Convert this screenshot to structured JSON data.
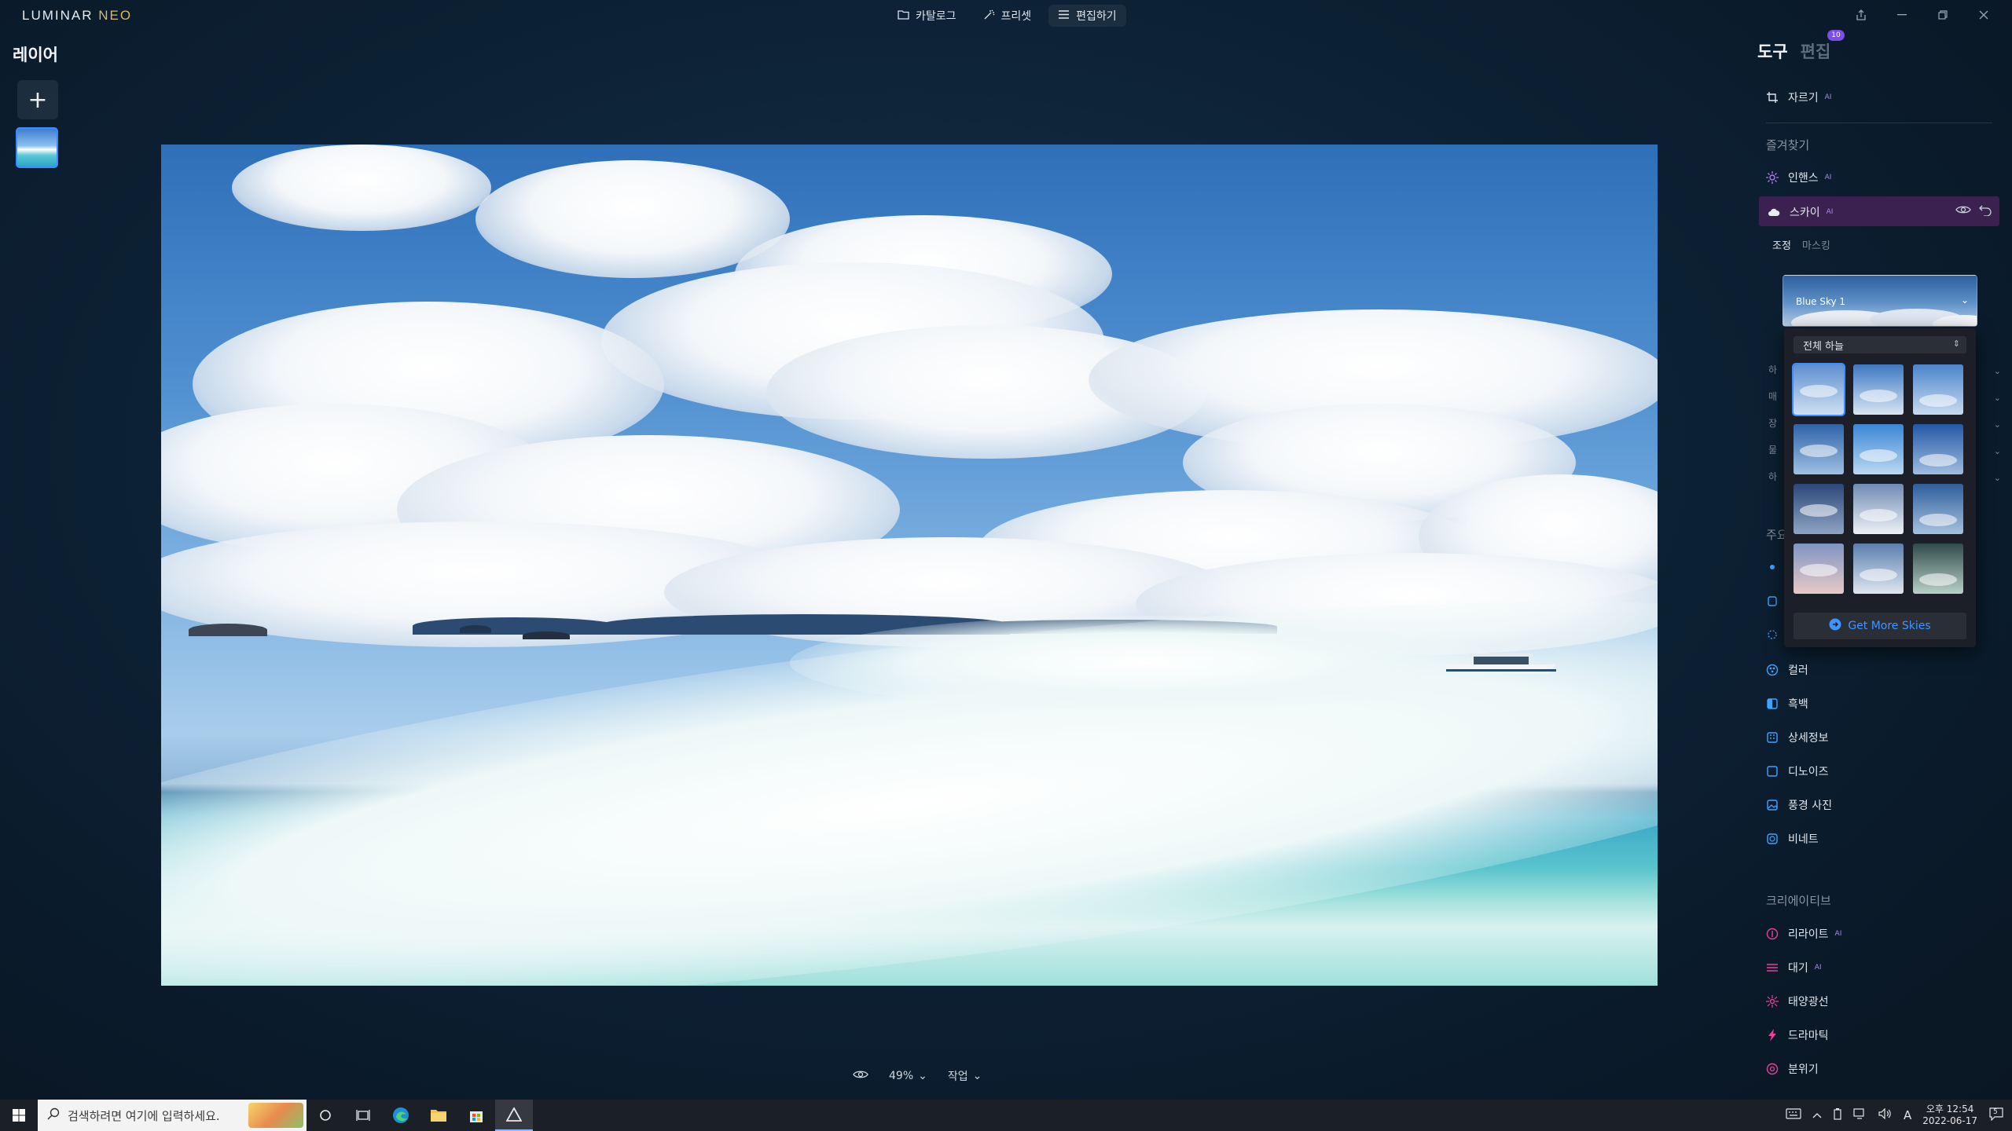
{
  "app": {
    "logo_main": "LUMINAR",
    "logo_accent": "NEO"
  },
  "modes": [
    {
      "label": "카탈로그",
      "icon": "folder-icon"
    },
    {
      "label": "프리셋",
      "icon": "magic-wand-icon"
    },
    {
      "label": "편집하기",
      "icon": "sliders-icon"
    }
  ],
  "window_controls": [
    "share-icon",
    "minimize-icon",
    "restore-icon",
    "close-icon"
  ],
  "layers": {
    "title": "레이어",
    "add_label": "+"
  },
  "bottom_bar": {
    "zoom": "49%",
    "action": "작업"
  },
  "right_panel": {
    "tab_tools": "도구",
    "tab_edits": "편집",
    "edits_badge": "10",
    "crop": "자르기",
    "favorites_label": "즐겨찾기",
    "enhance": "인핸스",
    "sky": "스카이",
    "sub_adjust": "조정",
    "sub_masking": "마스킹",
    "collapsed_rows": [
      "하",
      "매",
      "장",
      "물",
      "하"
    ],
    "essentials_label": "주요",
    "essentials": [
      {
        "label": "컬러",
        "icon": "color-icon"
      },
      {
        "label": "흑백",
        "icon": "bw-icon"
      },
      {
        "label": "상세정보",
        "icon": "details-icon"
      },
      {
        "label": "디노이즈",
        "icon": "denoise-icon"
      },
      {
        "label": "풍경 사진",
        "icon": "landscape-icon"
      },
      {
        "label": "비네트",
        "icon": "vignette-icon"
      }
    ],
    "creative_label": "크리에이티브",
    "creative": [
      {
        "label": "리라이트",
        "icon": "relight-icon"
      },
      {
        "label": "대기",
        "icon": "atmosphere-icon"
      },
      {
        "label": "태양광선",
        "icon": "sunrays-icon"
      },
      {
        "label": "드라마틱",
        "icon": "dramatic-icon"
      },
      {
        "label": "분위기",
        "icon": "mood-icon"
      }
    ],
    "ai_mark": "AI"
  },
  "sky_picker": {
    "selected": "Blue Sky 1",
    "category": "전체 하늘",
    "thumbnails": [
      {
        "top": "#5d8fd0",
        "bottom": "#cfe0f1"
      },
      {
        "top": "#3d78c2",
        "bottom": "#d9e6f2"
      },
      {
        "top": "#4a84cc",
        "bottom": "#c8dbee"
      },
      {
        "top": "#2e63a8",
        "bottom": "#9fc0e3"
      },
      {
        "top": "#3a86d6",
        "bottom": "#bcd8f1"
      },
      {
        "top": "#2458a6",
        "bottom": "#9ebde0"
      },
      {
        "top": "#2c4778",
        "bottom": "#8ea4c4"
      },
      {
        "top": "#6f8bb4",
        "bottom": "#eef1f5"
      },
      {
        "top": "#2f5e9b",
        "bottom": "#a5c2df"
      },
      {
        "top": "#7e95c2",
        "bottom": "#e8c9c6"
      },
      {
        "top": "#5a7fae",
        "bottom": "#dfe6ee"
      },
      {
        "top": "#2f4b4a",
        "bottom": "#b9cfc8"
      }
    ],
    "get_more": "Get More Skies"
  },
  "taskbar": {
    "search_placeholder": "검색하려면 여기에 입력하세요.",
    "time": "오후 12:54",
    "date": "2022-06-17",
    "ime": "A",
    "notifications": "5"
  }
}
